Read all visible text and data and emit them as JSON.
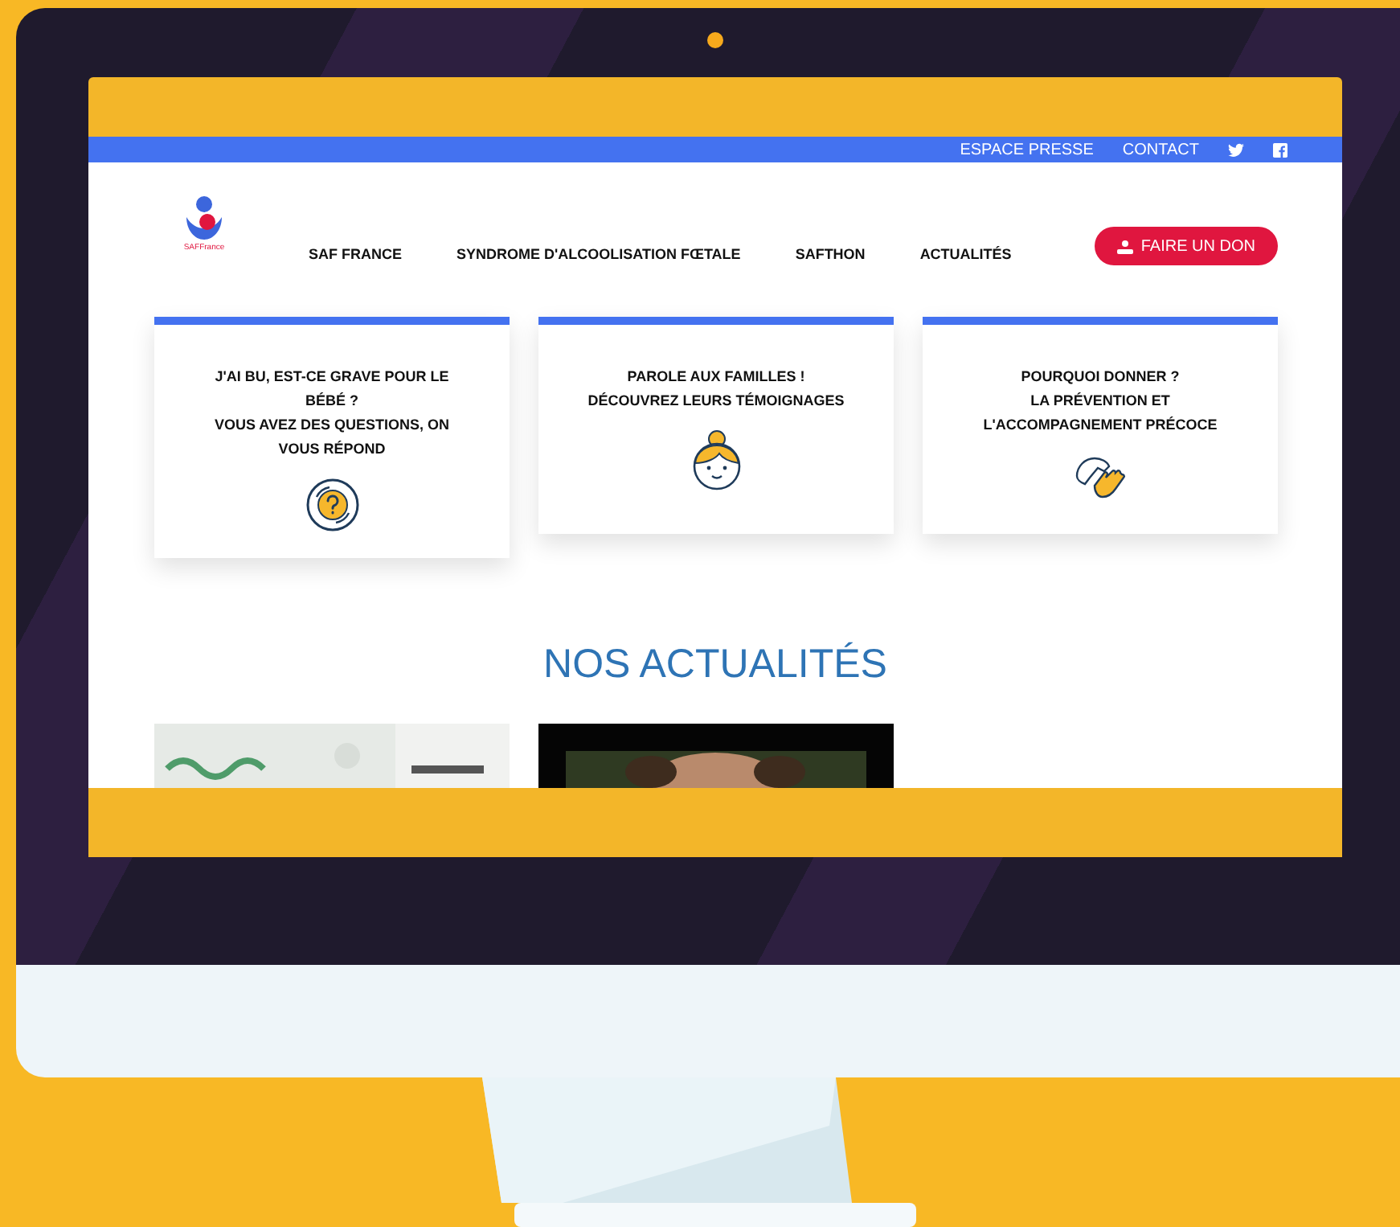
{
  "topbar": {
    "links": [
      "ESPACE PRESSE",
      "CONTACT"
    ],
    "social": [
      {
        "kind": "twitter"
      },
      {
        "kind": "facebook"
      }
    ]
  },
  "header": {
    "logo_text": "SAFFrance",
    "nav": [
      "SAF FRANCE",
      "SYNDROME D'ALCOOLISATION FŒTALE",
      "SAFTHON",
      "ACTUALITÉS"
    ],
    "donate": "FAIRE UN DON"
  },
  "cards": [
    {
      "kind": "question",
      "paragraphs": [
        "J'AI BU, EST-CE GRAVE POUR LE BÉBÉ ?",
        "VOUS AVEZ DES QUESTIONS, ON VOUS RÉPOND"
      ]
    },
    {
      "kind": "girl",
      "paragraphs": [
        "PAROLE AUX FAMILLES !",
        "DÉCOUVREZ LEURS TÉMOIGNAGES"
      ]
    },
    {
      "kind": "hands",
      "paragraphs": [
        "POURQUOI DONNER ?",
        "LA PRÉVENTION ET L'ACCOMPAGNEMENT PRÉCOCE"
      ]
    }
  ],
  "news": {
    "title": "NOS ACTUALITÉS"
  }
}
